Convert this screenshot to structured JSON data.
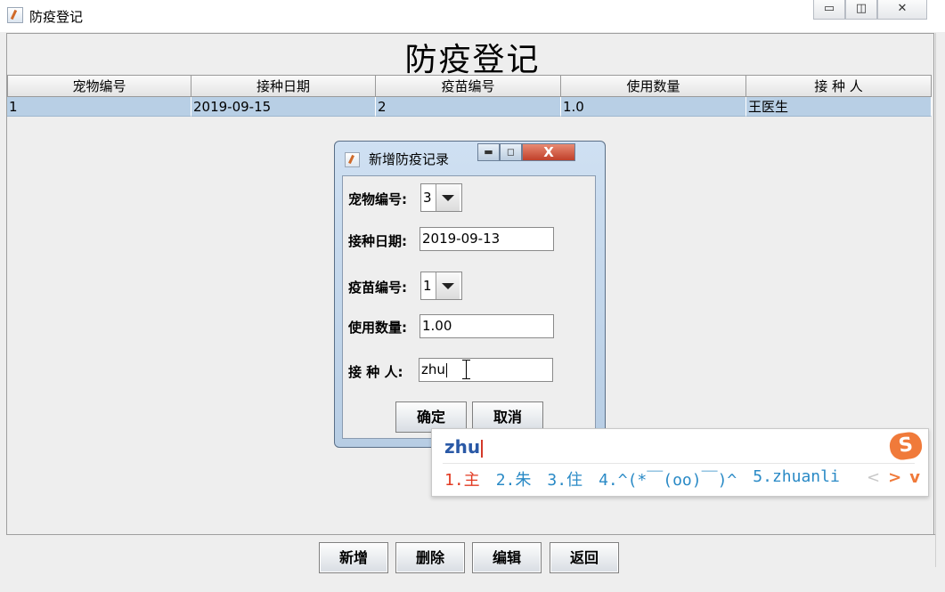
{
  "window": {
    "title": "防疫登记",
    "controls": {
      "minimize": "▭",
      "maximize": "◫",
      "close": "✕"
    }
  },
  "heading": "防疫登记",
  "table": {
    "columns": [
      "宠物编号",
      "接种日期",
      "疫苗编号",
      "使用数量",
      "接 种 人"
    ],
    "rows": [
      [
        "1",
        "2019-09-15",
        "2",
        "1.0",
        "王医生"
      ]
    ]
  },
  "buttons": {
    "add": "新增",
    "delete": "删除",
    "edit": "编辑",
    "back": "返回"
  },
  "dialog": {
    "title": "新增防疫记录",
    "controls": {
      "minimize": "▬",
      "maximize": "◻",
      "close": "X"
    },
    "fields": {
      "pet_id": {
        "label": "宠物编号:",
        "value": "3"
      },
      "vaccination_date": {
        "label": "接种日期:",
        "value": "2019-09-13"
      },
      "vaccine_id": {
        "label": "疫苗编号:",
        "value": "1"
      },
      "quantity": {
        "label": "使用数量:",
        "value": "1.00"
      },
      "vaccinator": {
        "label": "接 种 人:",
        "value": "zhu"
      }
    },
    "confirm": "确定",
    "cancel": "取消"
  },
  "ime": {
    "input": "zhu",
    "candidates": [
      "1.主",
      "2.朱",
      "3.住",
      "4.^(*￣(oo)￣)^",
      "5.zhuanli"
    ],
    "nav": {
      "prev": "<",
      "next": ">",
      "expand": "v"
    },
    "logo": "S",
    "colors": {
      "first_candidate": "#e23a22",
      "candidate": "#2a8ac6",
      "input": "#2a59a6",
      "logo": "#f07a3a"
    }
  },
  "colors": {
    "selected_row": "#b8cfe5",
    "dialog_frame": "#b7cde4",
    "dialog_close": "#c0402a"
  }
}
